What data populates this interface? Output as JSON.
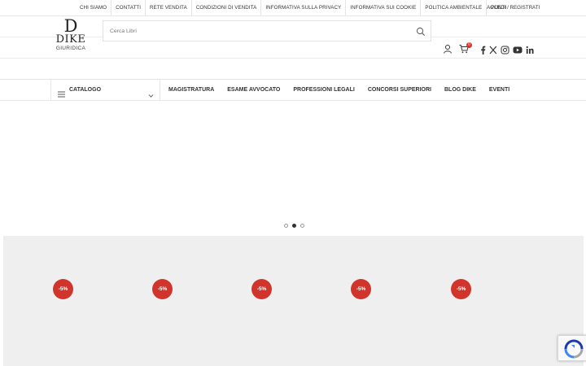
{
  "topbar": {
    "links": [
      "CHI SIAMO",
      "CONTATTI",
      "RETE VENDITA",
      "CONDIZIONI DI VENDITA",
      "INFORMATIVA SULLA PRIVACY",
      "INFORMATIVA SUI COOKIE",
      "POLITICA AMBIENTALE",
      "PUNTI"
    ],
    "account": "ACCEDI / REGISTRATI"
  },
  "logo": {
    "mark": "D",
    "name": "DIKE",
    "sub": "GIURIDICA"
  },
  "search": {
    "placeholder": "Cerca Libri"
  },
  "cart": {
    "count": "0"
  },
  "icons": [
    "search-icon",
    "user-icon",
    "cart-icon",
    "facebook-icon",
    "x-icon",
    "instagram-icon",
    "youtube-icon",
    "linkedin-icon",
    "menu-icon",
    "chevron-down-icon"
  ],
  "nav": {
    "catalog": "CATALOGO",
    "items": [
      "MAGISTRATURA",
      "ESAME AVVOCATO",
      "PROFESSIONI LEGALI",
      "CONCORSI SUPERIORI",
      "BLOG DIKE",
      "EVENTI"
    ]
  },
  "slider": {
    "active_index": 1,
    "count": 3
  },
  "products": {
    "badges": [
      "-5%",
      "-5%",
      "-5%",
      "-5%",
      "-5%"
    ]
  },
  "colors": {
    "accent": "#d1342a",
    "product_bg": "#efefef"
  }
}
